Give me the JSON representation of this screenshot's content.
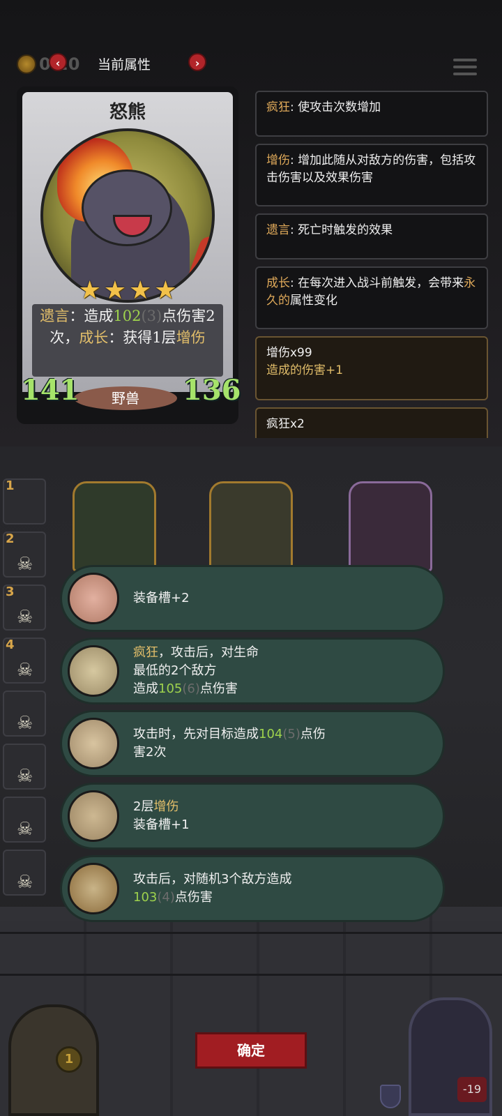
{
  "header": {
    "coin_value": "0 20",
    "title": "当前属性",
    "prev_label": "‹",
    "next_label": "›"
  },
  "card": {
    "name": "怒熊",
    "stars": 4,
    "desc": {
      "kw1": "遗言",
      "t1": "：造成",
      "v1": "102",
      "v1_note": "(3)",
      "t2": "点伤害2次，",
      "kw2": "成长",
      "t3": "：获得1层",
      "kw3": "增伤"
    },
    "attack": "141",
    "health": "136",
    "tribe": "野兽"
  },
  "keywords": [
    {
      "key": "疯狂",
      "text": ": 使攻击次数增加"
    },
    {
      "key": "增伤",
      "text": ": 增加此随从对敌方的伤害，包括攻击伤害以及效果伤害"
    },
    {
      "key": "遗言",
      "text": ": 死亡时触发的效果"
    },
    {
      "key": "成长",
      "text": ": 在每次进入战斗前触发，会带来",
      "key2": "永久的",
      "text2": "属性变化"
    }
  ],
  "effects": [
    {
      "line1": "增伤x99",
      "line2": "造成的伤害+1"
    },
    {
      "line1": "疯狂x2"
    }
  ],
  "side_slots": [
    "1",
    "2",
    "3",
    "4",
    "",
    "",
    "",
    ""
  ],
  "options": [
    {
      "icon": "pig-icon",
      "lines": [
        "装备槽+2"
      ]
    },
    {
      "icon": "scythe-icon",
      "kw": "疯狂",
      "l1": "，攻击后，对生命",
      "l2": "最低的2个敌方",
      "l3a": "造成",
      "v": "105",
      "note": "(6)",
      "l3b": "点伤害"
    },
    {
      "icon": "crossbow-icon",
      "l1a": "攻击时，先对目标造成",
      "v": "104",
      "note": "(5)",
      "l1b": "点伤",
      "l2": "害2次"
    },
    {
      "icon": "gauntlet-icon",
      "l1a": "2层",
      "kw": "增伤",
      "l2": "装备槽+1"
    },
    {
      "icon": "rock-icon",
      "l1": "攻击后，对随机3个敌方造成",
      "v": "103",
      "note": "(4)",
      "l2b": "点伤害"
    }
  ],
  "confirm_label": "确定",
  "door_value": "1",
  "hero_hp": "-19"
}
